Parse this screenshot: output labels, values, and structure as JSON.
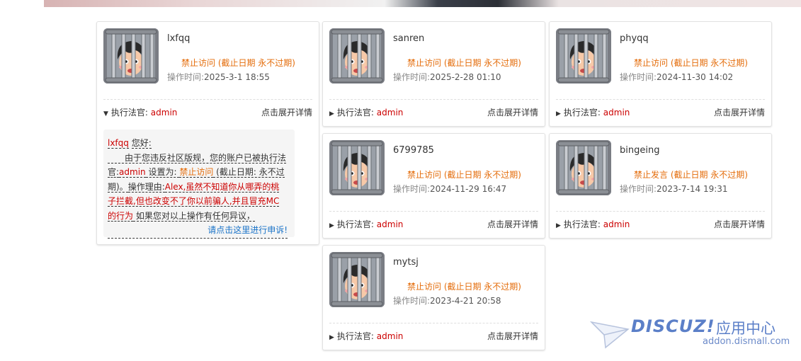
{
  "cards": [
    {
      "username": "lxfqq",
      "status": "禁止访问 (截止日期 永不过期)",
      "optime_label": "操作时间:",
      "optime": "2025-3-1 18:55",
      "arrow": "▼",
      "judge_label": "执行法官:",
      "judge": "admin",
      "expand": "点击展开详情",
      "expanded": true,
      "detail": {
        "user": "lxfqq",
        "greeting": "您好:",
        "p1": "由于您违反社区版规，您的账户已被执行法官:",
        "judge": "admin",
        "set_as": " 设置为: ",
        "action": "禁止访问",
        "deadline": " (截止日期: 永不过期)。",
        "reason_label": "操作理由:",
        "reason": "Alex,虽然不知道你从哪弄的桃子拦截,但也改变不了你以前骗人,并且冒充MC的行为",
        "tail": " 如果您对以上操作有任何异议，",
        "appeal": "请点击这里进行申诉!"
      }
    },
    {
      "username": "sanren",
      "status": "禁止访问 (截止日期 永不过期)",
      "optime_label": "操作时间:",
      "optime": "2025-2-28 01:10",
      "arrow": "▶",
      "judge_label": "执行法官:",
      "judge": "admin",
      "expand": "点击展开详情"
    },
    {
      "username": "phyqq",
      "status": "禁止访问 (截止日期 永不过期)",
      "optime_label": "操作时间:",
      "optime": "2024-11-30 14:02",
      "arrow": "▶",
      "judge_label": "执行法官:",
      "judge": "admin",
      "expand": "点击展开详情"
    },
    {
      "username": "6799785",
      "status": "禁止访问 (截止日期 永不过期)",
      "optime_label": "操作时间:",
      "optime": "2024-11-29 16:47",
      "arrow": "▶",
      "judge_label": "执行法官:",
      "judge": "admin",
      "expand": "点击展开详情"
    },
    {
      "username": "bingeing",
      "status": "禁止发言 (截止日期 永不过期)",
      "optime_label": "操作时间:",
      "optime": "2023-7-14 19:31",
      "arrow": "▶",
      "judge_label": "执行法官:",
      "judge": "admin",
      "expand": "点击展开详情"
    },
    {
      "username": "mytsj",
      "status": "禁止访问 (截止日期 永不过期)",
      "optime_label": "操作时间:",
      "optime": "2023-4-21 20:58",
      "arrow": "▶",
      "judge_label": "执行法官:",
      "judge": "admin",
      "expand": "点击展开详情"
    }
  ],
  "avatar_icon": "jailed-user-avatar-icon",
  "colors": {
    "status": "#e46c0a",
    "judge": "#cc0000",
    "appeal_link": "#1a73c8",
    "watermark": "#5b7fc8"
  },
  "watermark": {
    "brand": "DISCUZ!",
    "center": "应用中心",
    "url": "addon.dismall.com"
  }
}
